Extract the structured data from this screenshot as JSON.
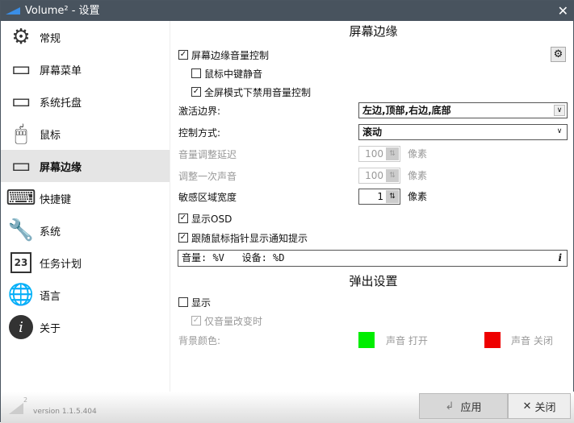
{
  "window": {
    "title": "Volume² - 设置",
    "close": "✕"
  },
  "sidebar": {
    "items": [
      {
        "label": "常规",
        "icon": "⚙"
      },
      {
        "label": "屏幕菜单",
        "icon": "▭"
      },
      {
        "label": "系统托盘",
        "icon": "▭"
      },
      {
        "label": "鼠标",
        "icon": "🖱"
      },
      {
        "label": "屏幕边缘",
        "icon": "▭"
      },
      {
        "label": "快捷键",
        "icon": "⌨"
      },
      {
        "label": "系统",
        "icon": "🔧"
      },
      {
        "label": "任务计划",
        "icon": "23"
      },
      {
        "label": "语言",
        "icon": "🌐"
      },
      {
        "label": "关于",
        "icon": "i"
      }
    ],
    "version": "version 1.1.5.404",
    "logo_sup": "2"
  },
  "edge": {
    "heading": "屏幕边缘",
    "enable": "屏幕边缘音量控制",
    "mute_middle": "鼠标中键静音",
    "fullscreen_disable": "全屏模式下禁用音量控制",
    "activate_label": "激活边界:",
    "activate_value": "左边,顶部,右边,底部",
    "control_label": "控制方式:",
    "control_value": "滚动",
    "delay_label": "音量调整延迟",
    "delay_value": "100",
    "step_label": "调整一次声音",
    "step_value": "100",
    "width_label": "敏感区域宽度",
    "width_value": "1",
    "unit": "像素",
    "show_osd": "显示OSD",
    "follow_mouse": "跟随鼠标指针显示通知提示",
    "format": "音量: %V   设备: %D",
    "info": "i"
  },
  "popup": {
    "heading": "弹出设置",
    "show": "显示",
    "only_change": "仅音量改变时",
    "bg_label": "背景颜色:",
    "on_label": "声音 打开",
    "off_label": "声音 关闭",
    "on_color": "#00ee00",
    "off_color": "#ee0000"
  },
  "footer": {
    "apply": "应用",
    "close": "关闭"
  }
}
